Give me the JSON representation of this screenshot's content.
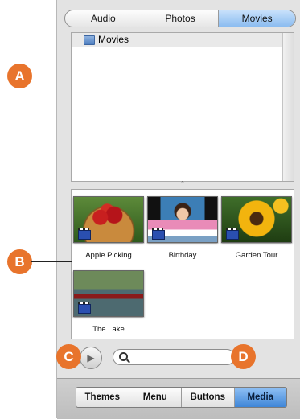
{
  "source_tabs": [
    {
      "label": "Audio",
      "active": false
    },
    {
      "label": "Photos",
      "active": false
    },
    {
      "label": "Movies",
      "active": true
    }
  ],
  "folder_list": {
    "items": [
      {
        "label": "Movies",
        "icon": "folder-movies-icon"
      }
    ]
  },
  "splitter_glyph": "ˆ",
  "movies": [
    {
      "label": "Apple Picking",
      "icon": "movie-clapper-icon"
    },
    {
      "label": "Birthday",
      "icon": "movie-clapper-icon"
    },
    {
      "label": "Garden Tour",
      "icon": "movie-clapper-icon"
    },
    {
      "label": "The Lake",
      "icon": "movie-clapper-icon"
    }
  ],
  "controls": {
    "play_glyph": "▶",
    "search_placeholder": ""
  },
  "bottom_tabs": [
    {
      "label": "Themes",
      "active": false
    },
    {
      "label": "Menu",
      "active": false
    },
    {
      "label": "Buttons",
      "active": false
    },
    {
      "label": "Media",
      "active": true
    }
  ],
  "callouts": {
    "a": "A",
    "b": "B",
    "c": "C",
    "d": "D"
  },
  "colors": {
    "callout": "#e8742c",
    "active_tab": "#3f86d8"
  }
}
